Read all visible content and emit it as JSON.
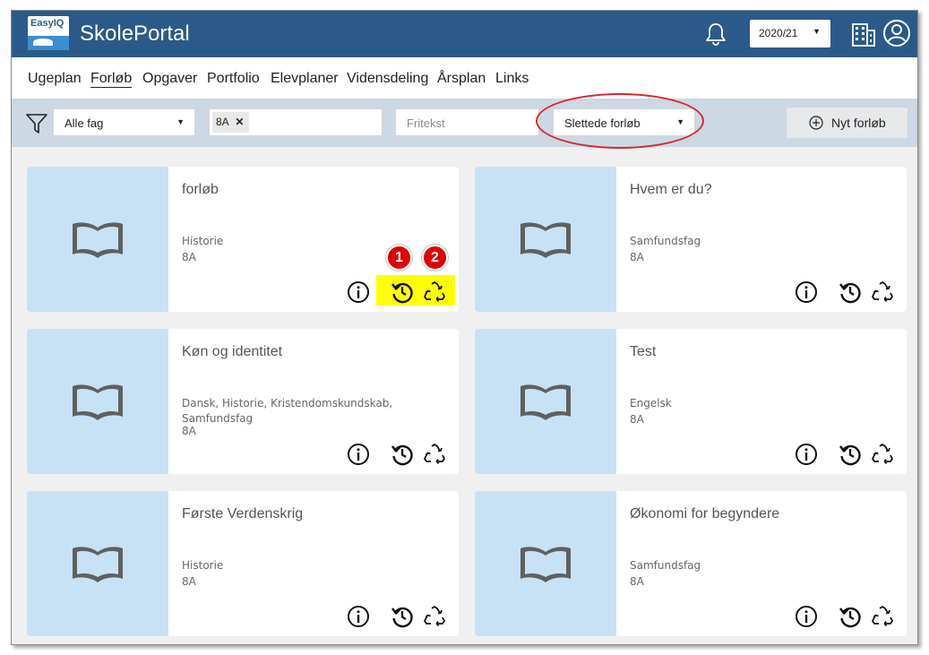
{
  "app": {
    "logo_text": "EasyIQ",
    "title": "SkolePortal"
  },
  "header": {
    "year": "2020/21",
    "colors": {
      "bar": "#2b5a8a"
    }
  },
  "nav": {
    "items": [
      {
        "label": "Ugeplan"
      },
      {
        "label": "Forløb",
        "active": true
      },
      {
        "label": "Opgaver"
      },
      {
        "label": "Portfolio"
      },
      {
        "label": "Elevplaner"
      },
      {
        "label": "Vidensdeling"
      },
      {
        "label": "Årsplan"
      },
      {
        "label": "Links"
      }
    ]
  },
  "filters": {
    "subject": "Alle fag",
    "class_chip": "8A",
    "chip_remove": "✕",
    "search_placeholder": "Fritekst",
    "status": "Slettede forløb",
    "new_button": "Nyt forløb"
  },
  "cards": [
    {
      "title": "forløb",
      "subjects": "Historie",
      "class": "8A",
      "highlighted": true,
      "badges": [
        "1",
        "2"
      ]
    },
    {
      "title": "Hvem er du?",
      "subjects": "Samfundsfag",
      "class": "8A"
    },
    {
      "title": "Køn og identitet",
      "subjects": "Dansk, Historie, Kristendomskundskab, Samfundsfag",
      "class": "8A"
    },
    {
      "title": "Test",
      "subjects": "Engelsk",
      "class": "8A"
    },
    {
      "title": "Første Verdenskrig",
      "subjects": "Historie",
      "class": "8A"
    },
    {
      "title": "Økonomi for begyndere",
      "subjects": "Samfundsfag",
      "class": "8A"
    }
  ],
  "icons": {
    "card_actions": [
      "info-icon",
      "restore-history-icon",
      "recycle-icon"
    ],
    "thumbnail": "open-book-icon"
  }
}
